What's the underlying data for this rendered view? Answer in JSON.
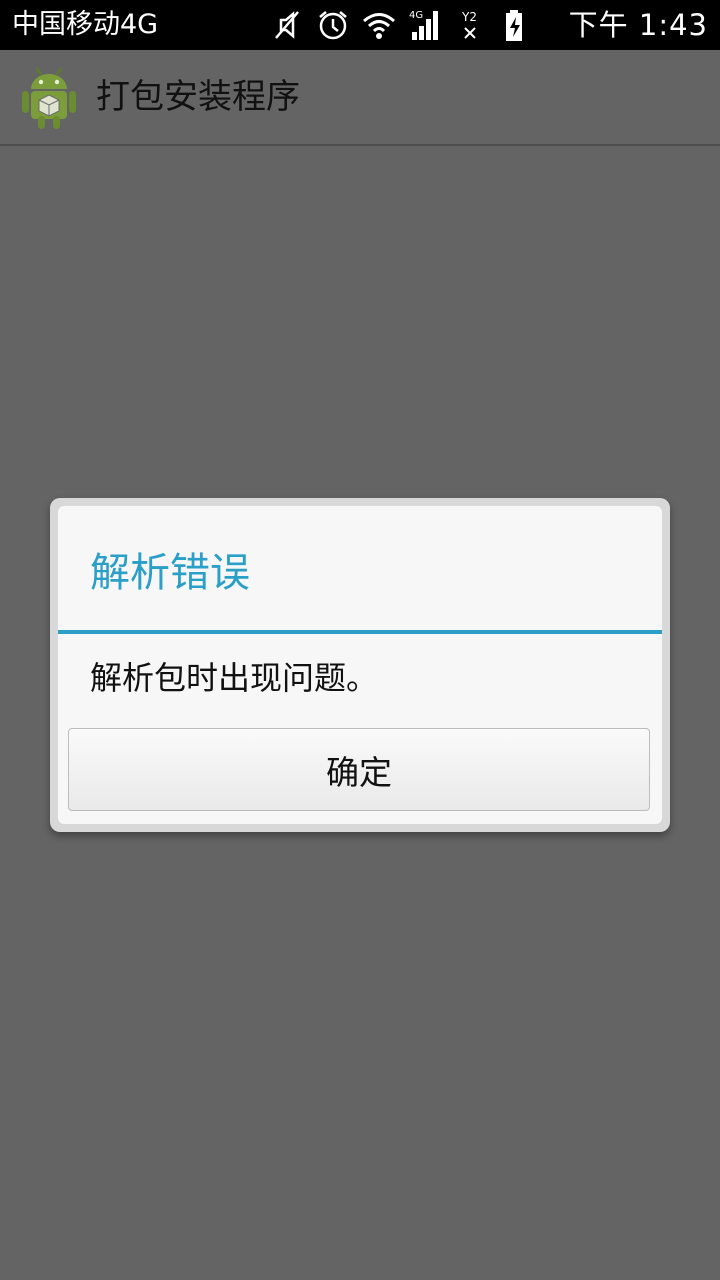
{
  "status_bar": {
    "carrier": "中国移动4G",
    "time": "下午 1:43",
    "icons": [
      "mute-icon",
      "alarm-icon",
      "wifi-icon",
      "signal-4g-icon",
      "sim2-no-signal-icon",
      "battery-charging-icon"
    ]
  },
  "action_bar": {
    "app_icon": "android-package-installer-icon",
    "title": "打包安装程序"
  },
  "dialog": {
    "title": "解析错误",
    "message": "解析包时出现问题。",
    "ok_button": "确定",
    "accent_color": "#2a9fc7"
  }
}
